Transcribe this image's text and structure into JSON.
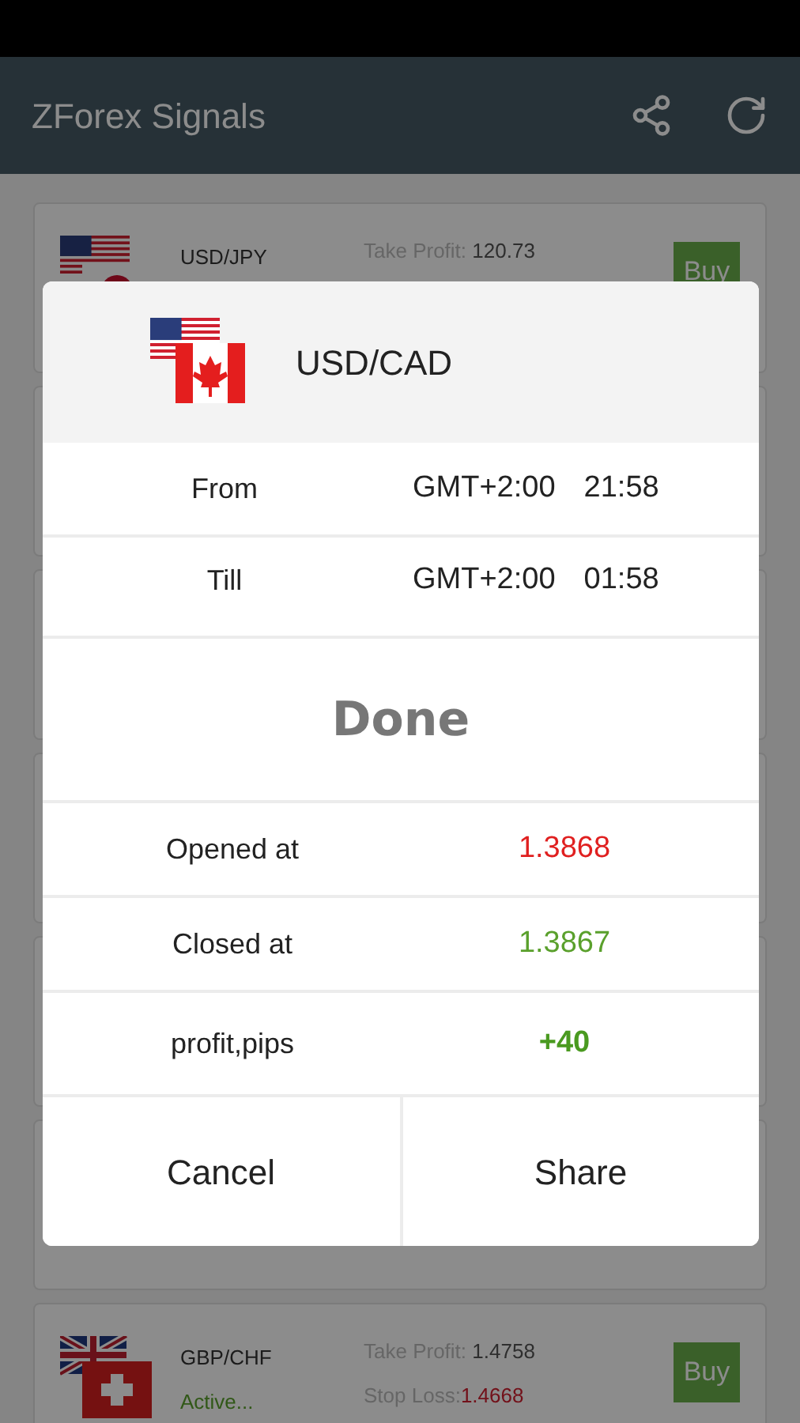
{
  "app_bar": {
    "title": "ZForex Signals"
  },
  "signals": [
    {
      "pair": "USD/JPY",
      "take_profit_label": "Take Profit:",
      "take_profit": "120.73",
      "action": "Buy"
    },
    {
      "pair": "GBP/CHF",
      "status": "Active...",
      "take_profit_label": "Take Profit:",
      "take_profit": "1.4758",
      "stop_loss_label": "Stop Loss:",
      "stop_loss": "1.4668",
      "action": "Buy"
    }
  ],
  "dialog": {
    "pair": "USD/CAD",
    "times": [
      {
        "label": "From",
        "zone": "GMT+2:00",
        "time": "21:58"
      },
      {
        "label": "Till",
        "zone": "GMT+2:00",
        "time": "01:58"
      }
    ],
    "status": "Done",
    "prices": [
      {
        "label": "Opened at",
        "value": "1.3868",
        "color": "#e02020"
      },
      {
        "label": "Closed at",
        "value": "1.3867",
        "color": "#5aa02c"
      },
      {
        "label": "profit,pips",
        "value": "+40",
        "color": "#4a9a20"
      }
    ],
    "buttons": [
      "Cancel",
      "Share"
    ]
  }
}
